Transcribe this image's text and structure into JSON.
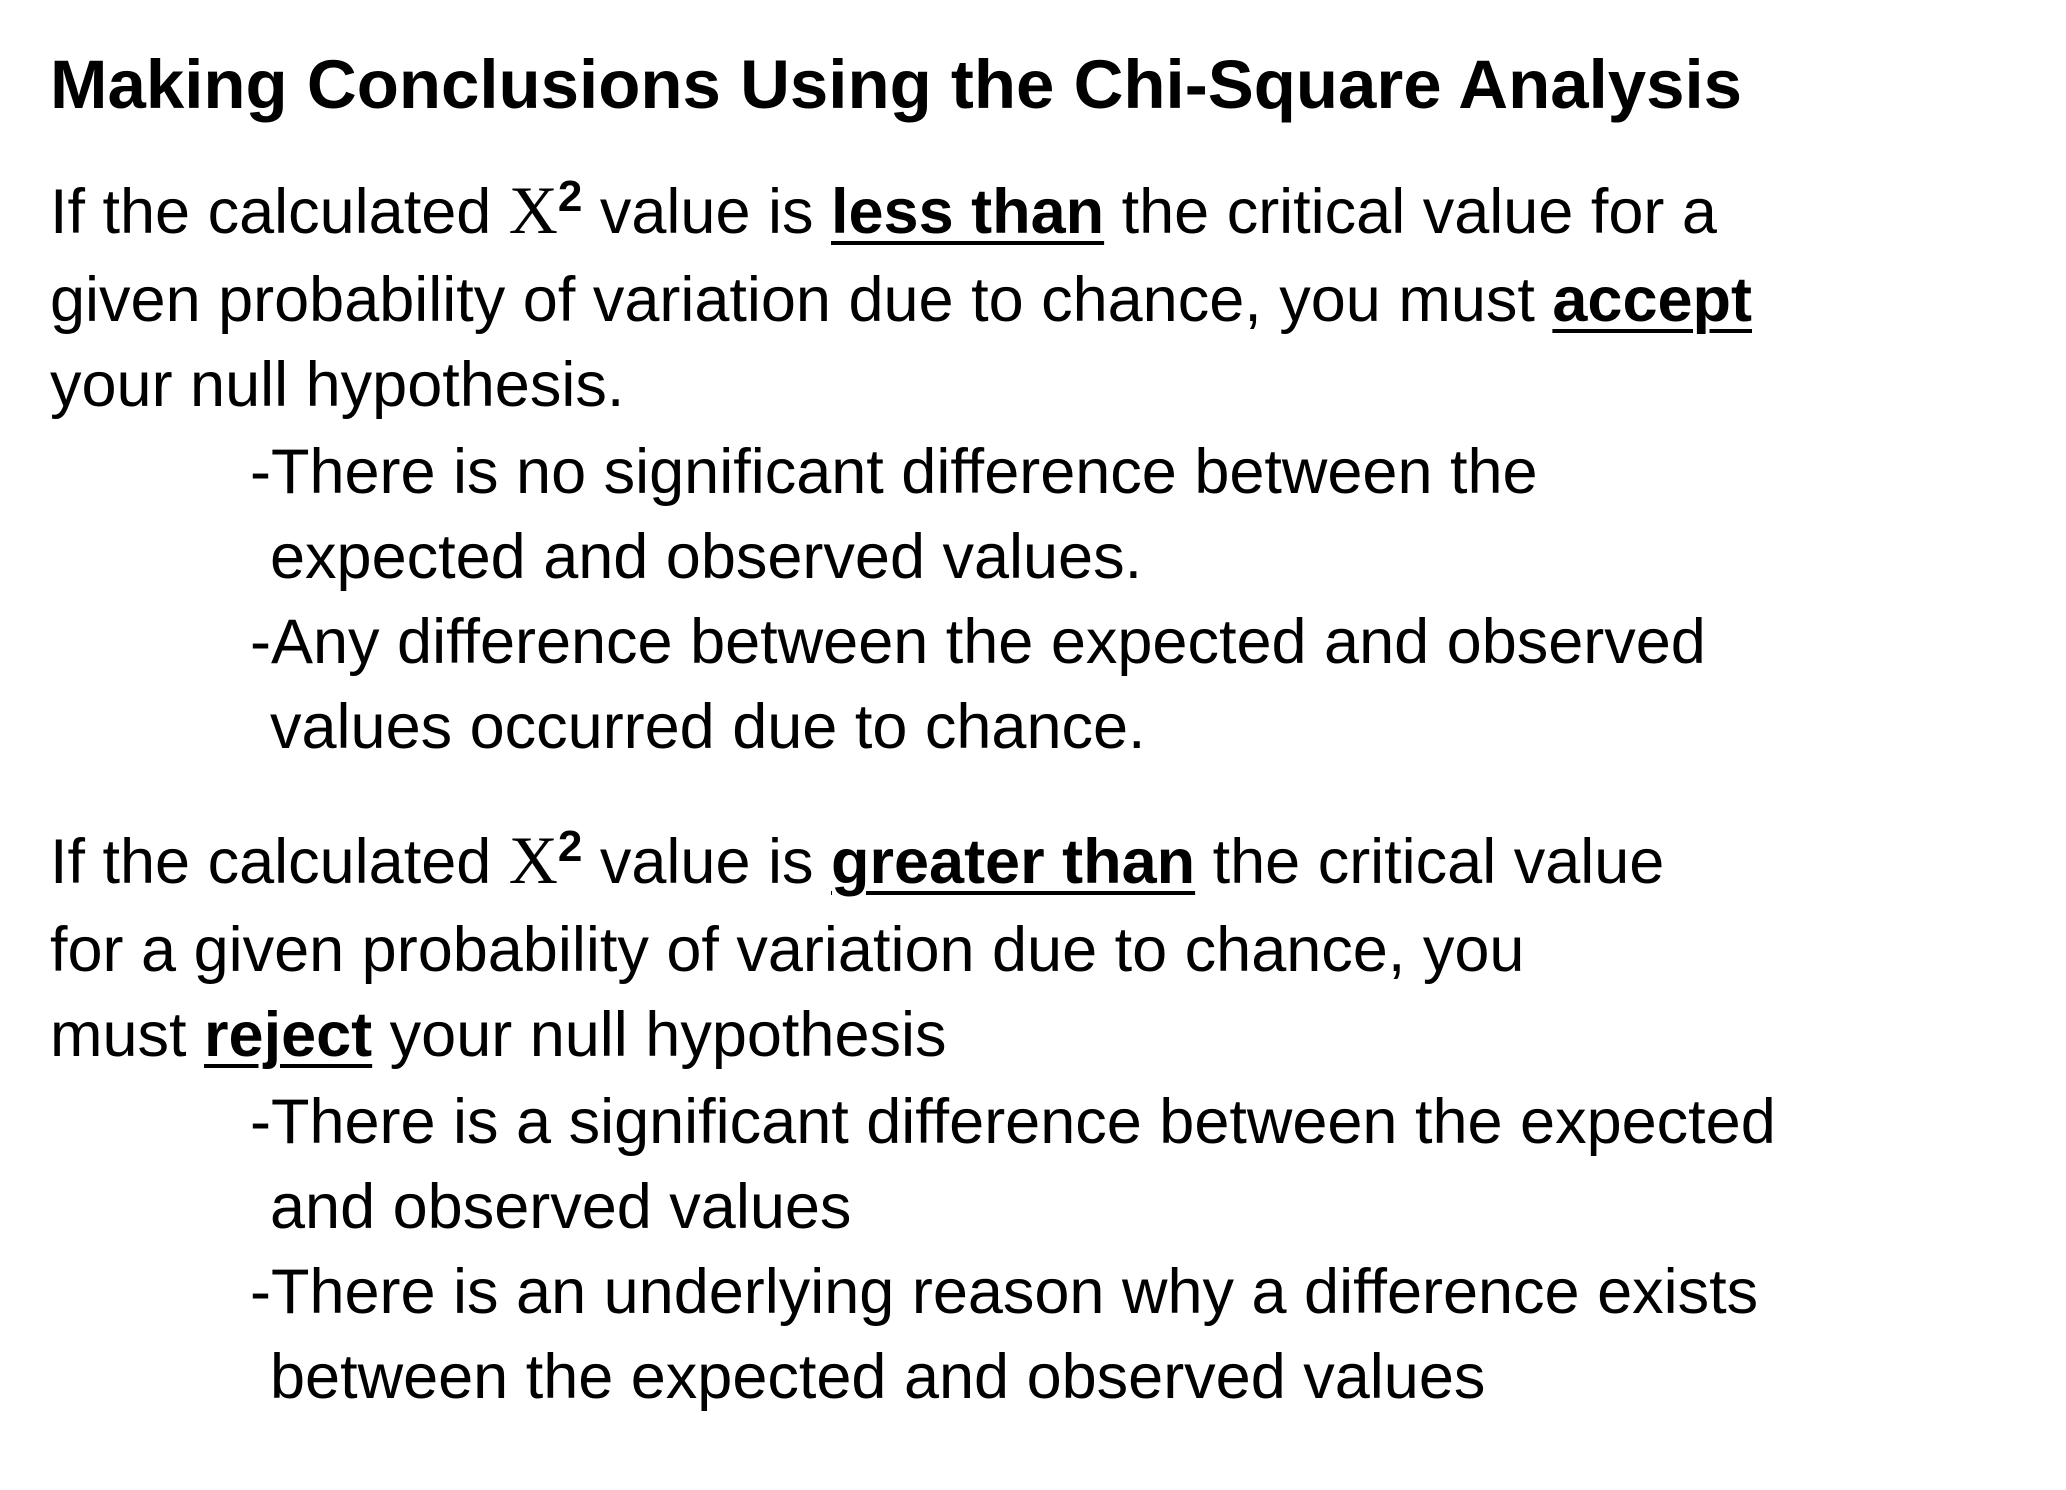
{
  "title": "Making Conclusions Using the Chi-Square Analysis",
  "symbol": {
    "letter": "X",
    "exponent": "2"
  },
  "section1": {
    "line1_pre": "If the calculated ",
    "line1_mid": " value is ",
    "line1_emph": "less than",
    "line1_post": " the critical value for a",
    "line2_pre": "given probability of variation due to chance, you must ",
    "line2_emph": "accept",
    "line3": "your null hypothesis.",
    "bullets": [
      {
        "line1": "-There is no significant difference between the",
        "line2": "expected and observed values."
      },
      {
        "line1": "-Any difference between the expected and observed",
        "line2": "values occurred due to chance."
      }
    ]
  },
  "section2": {
    "line1_pre": "If the calculated ",
    "line1_mid": " value is ",
    "line1_emph": "greater than",
    "line1_post": " the critical value",
    "line2": "for a given probability of variation due to chance, you",
    "line3_pre": "must ",
    "line3_emph": "reject",
    "line3_post": " your null hypothesis",
    "bullets": [
      {
        "line1": "-There is a significant difference between the expected",
        "line2": "and observed values"
      },
      {
        "line1": "-There is an underlying reason why a difference exists",
        "line2": "between the expected and observed values"
      }
    ]
  }
}
